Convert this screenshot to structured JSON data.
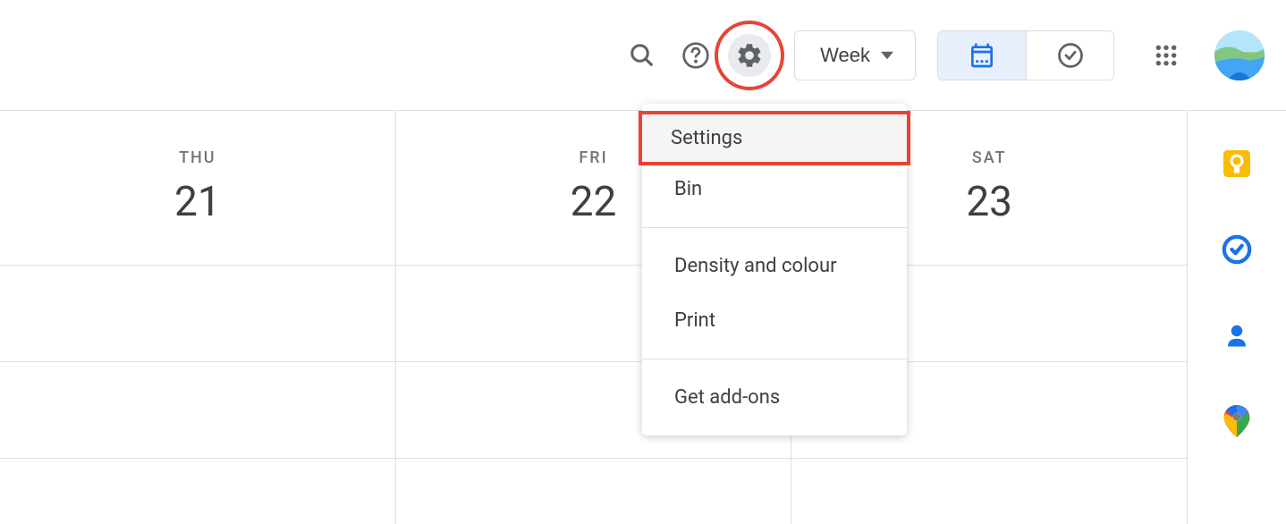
{
  "header": {
    "search_label": "Search",
    "help_label": "Support",
    "settings_label": "Settings menu",
    "view_selector": "Week",
    "apps_label": "Google apps"
  },
  "calendar": {
    "days": [
      {
        "name": "THU",
        "number": "21"
      },
      {
        "name": "FRI",
        "number": "22"
      },
      {
        "name": "SAT",
        "number": "23"
      }
    ]
  },
  "settings_menu": {
    "items": [
      {
        "label": "Settings",
        "highlighted": true
      },
      {
        "label": "Bin",
        "highlighted": false
      }
    ],
    "items2": [
      {
        "label": "Density and colour"
      },
      {
        "label": "Print"
      }
    ],
    "items3": [
      {
        "label": "Get add-ons"
      }
    ]
  },
  "side_panel": {
    "keep": "Keep",
    "tasks": "Tasks",
    "contacts": "Contacts",
    "maps": "Maps"
  }
}
